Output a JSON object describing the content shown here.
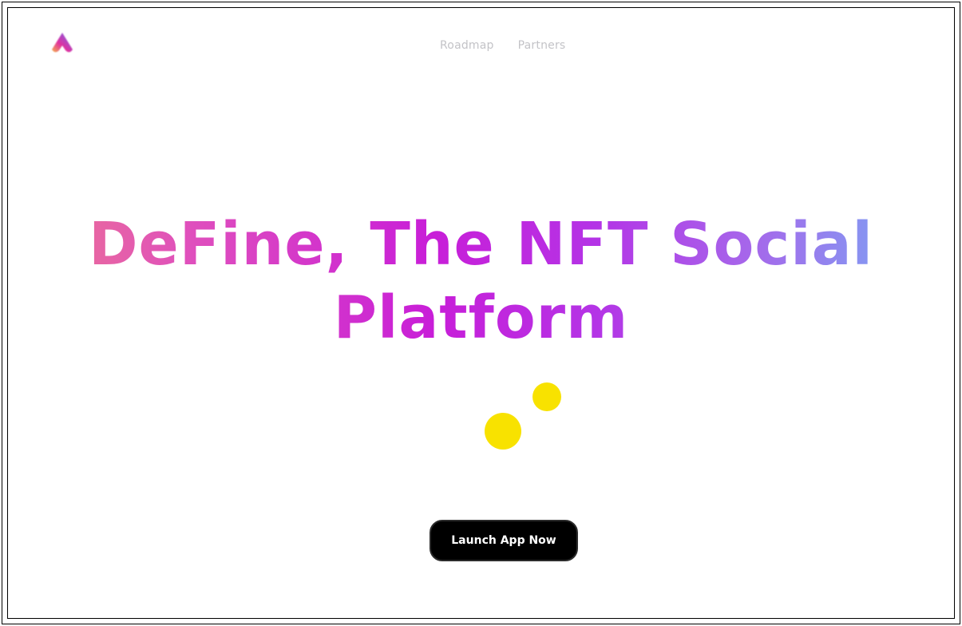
{
  "nav": {
    "items": [
      {
        "label": "Roadmap"
      },
      {
        "label": "Partners"
      }
    ]
  },
  "hero": {
    "line1": "DeFine, The NFT Social",
    "line2": "Platform"
  },
  "cta": {
    "label": "Launch App Now"
  },
  "colors": {
    "dot": "#f8e200",
    "cta_bg": "#000000",
    "nav_text": "#c3c3c7",
    "gradient": [
      "#ef7a8c",
      "#df4fbd",
      "#c81ed8",
      "#b434e6",
      "#a667ea",
      "#6fb7f7"
    ]
  },
  "icons": {
    "logo": "define-logo-icon"
  }
}
